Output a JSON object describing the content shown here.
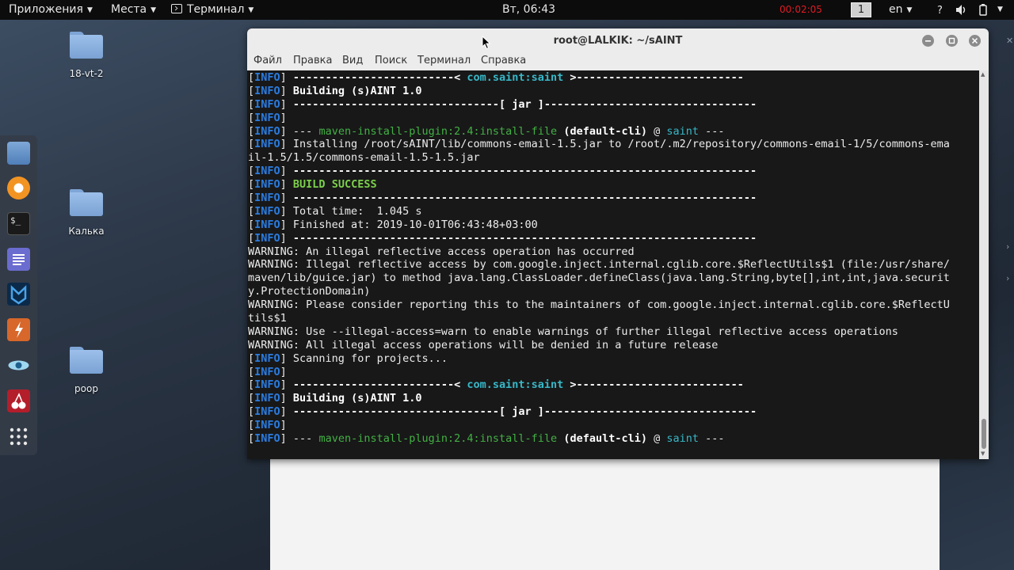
{
  "top_panel": {
    "applications": "Приложения",
    "places": "Места",
    "terminal": "Терминал",
    "clock": "Вт, 06:43",
    "recording": "00:02:05",
    "workspace": "1",
    "language": "en"
  },
  "desktop_icons": [
    {
      "label": "18-vt-2"
    },
    {
      "label": "Калька"
    },
    {
      "label": "poop"
    }
  ],
  "terminal_window": {
    "title": "root@LALKIK: ~/sAINT",
    "menu": [
      "Файл",
      "Правка",
      "Вид",
      "Поиск",
      "Терминал",
      "Справка"
    ]
  },
  "terminal_lines": [
    "[INFO] -------------------------< com.saint:saint >--------------------------",
    "[INFO] Building (s)AINT 1.0",
    "[INFO] --------------------------------[ jar ]---------------------------------",
    "[INFO]",
    "[INFO] --- maven-install-plugin:2.4:install-file (default-cli) @ saint ---",
    "[INFO] Installing /root/sAINT/lib/commons-email-1.5.jar to /root/.m2/repository/commons-email-1/5/commons-ema",
    "il-1.5/1.5/commons-email-1.5-1.5.jar",
    "[INFO] ------------------------------------------------------------------------",
    "[INFO] BUILD SUCCESS",
    "[INFO] ------------------------------------------------------------------------",
    "[INFO] Total time:  1.045 s",
    "[INFO] Finished at: 2019-10-01T06:43:48+03:00",
    "[INFO] ------------------------------------------------------------------------",
    "WARNING: An illegal reflective access operation has occurred",
    "WARNING: Illegal reflective access by com.google.inject.internal.cglib.core.$ReflectUtils$1 (file:/usr/share/",
    "maven/lib/guice.jar) to method java.lang.ClassLoader.defineClass(java.lang.String,byte[],int,int,java.securit",
    "y.ProtectionDomain)",
    "WARNING: Please consider reporting this to the maintainers of com.google.inject.internal.cglib.core.$ReflectU",
    "tils$1",
    "WARNING: Use --illegal-access=warn to enable warnings of further illegal reflective access operations",
    "WARNING: All illegal access operations will be denied in a future release",
    "[INFO] Scanning for projects...",
    "[INFO]",
    "[INFO] -------------------------< com.saint:saint >--------------------------",
    "[INFO] Building (s)AINT 1.0",
    "[INFO] --------------------------------[ jar ]---------------------------------",
    "[INFO]",
    "[INFO] --- maven-install-plugin:2.4:install-file (default-cli) @ saint ---"
  ],
  "dock_icons": [
    "files-icon",
    "firefox-icon",
    "terminal-icon",
    "text-editor-icon",
    "metasploit-icon",
    "burpsuite-icon",
    "eye-icon",
    "cherrytree-icon",
    "app-grid-icon"
  ]
}
